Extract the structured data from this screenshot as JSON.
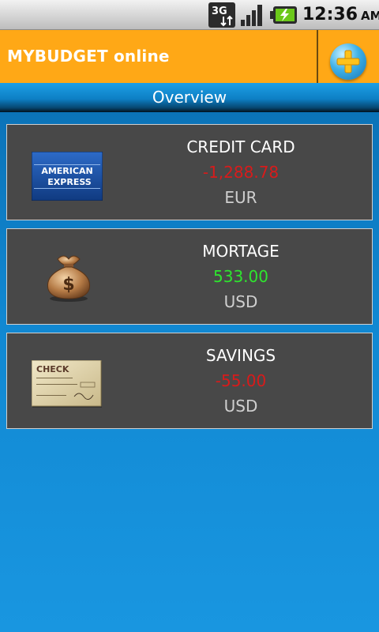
{
  "status_bar": {
    "network_type": "3G",
    "network_icon": "3g-data-icon",
    "signal_icon": "signal-strength-icon",
    "battery_icon": "battery-charging-icon",
    "time": "12:36",
    "ampm": "AM"
  },
  "header": {
    "title": "MYBUDGET online",
    "add_icon": "plus-icon",
    "brand_color": "#ffa816"
  },
  "section": {
    "title": "Overview"
  },
  "accounts": [
    {
      "name": "CREDIT CARD",
      "amount": "-1,288.78",
      "currency": "EUR",
      "amount_color": "#d81b1b",
      "icon": "american-express-card-icon",
      "icon_text_1": "AMERICAN",
      "icon_text_2": "EXPRESS"
    },
    {
      "name": "MORTAGE",
      "amount": "533.00",
      "currency": "USD",
      "amount_color": "#2ee52e",
      "icon": "money-bag-icon"
    },
    {
      "name": "SAVINGS",
      "amount": "-55.00",
      "currency": "USD",
      "amount_color": "#d81b1b",
      "icon": "check-icon",
      "icon_text_1": "CHECK"
    }
  ]
}
